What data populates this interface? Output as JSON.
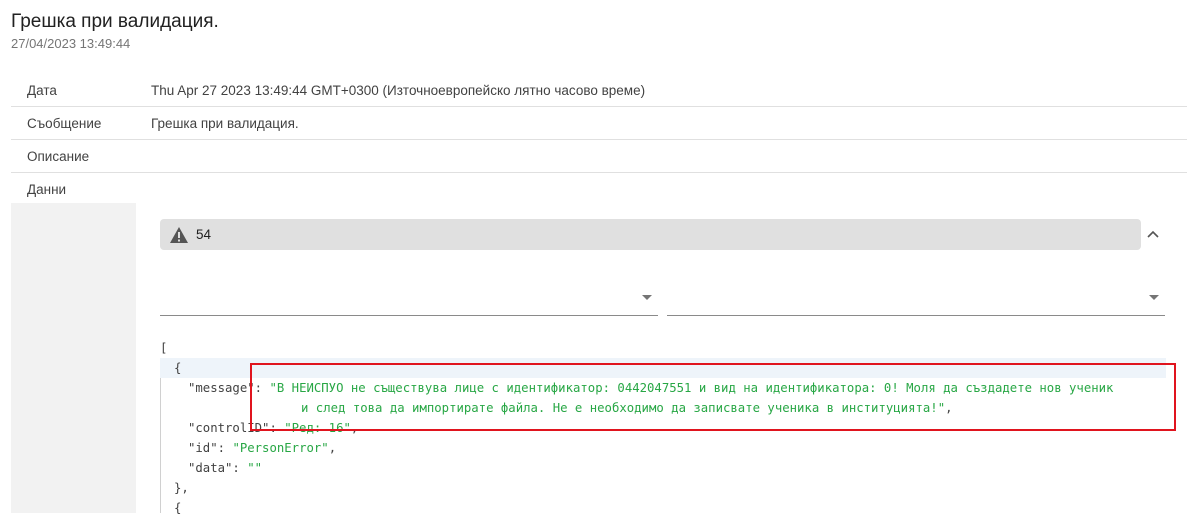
{
  "header": {
    "title": "Грешка при валидация.",
    "timestamp": "27/04/2023 13:49:44"
  },
  "properties": [
    {
      "key": "Дата",
      "value": "Thu Apr 27 2023 13:49:44 GMT+0300 (Източноевропейско лятно часово време)"
    },
    {
      "key": "Съобщение",
      "value": "Грешка при валидация."
    },
    {
      "key": "Описание",
      "value": ""
    },
    {
      "key": "Данни",
      "value": ""
    }
  ],
  "panel": {
    "warning_icon": "warning-triangle-icon",
    "count": "54",
    "collapse_icon": "chevron-up-icon"
  },
  "json_view": {
    "open_bracket": "[",
    "open_brace": "{",
    "message_key": "\"message\"",
    "message_value_line1": "\"В НЕИСПУО не съществува лице с идентификатор: 0442047551 и вид на идентификатора: 0! Моля да създадете нов ученик",
    "message_value_line2": "и след това да импортирате файла. Не е необходимо да записвате ученика в институцията!\"",
    "control_key": "\"controlID\"",
    "control_value": "\"Ред: 16\"",
    "id_key": "\"id\"",
    "id_value": "\"PersonError\"",
    "data_key": "\"data\"",
    "data_value": "\"\"",
    "close_brace": "},",
    "next_brace": "{"
  },
  "colors": {
    "string_value": "#28a745",
    "highlight_box": "#e0141e"
  }
}
